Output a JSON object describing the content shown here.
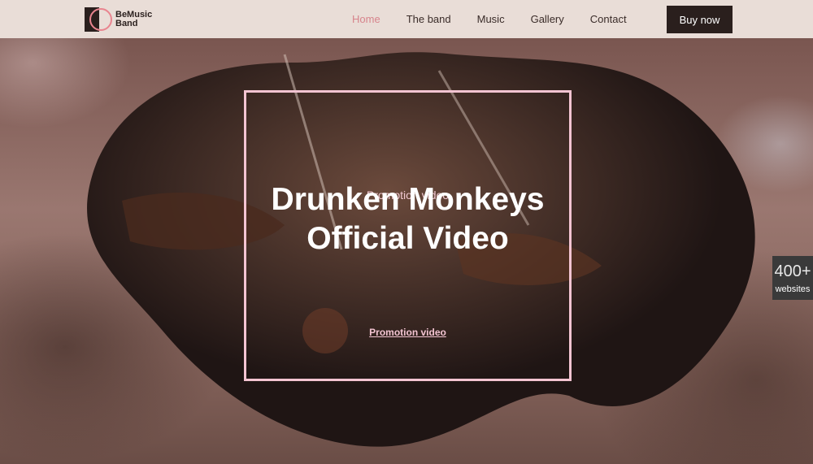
{
  "header": {
    "logo_text": "BeMusic Band",
    "nav": [
      {
        "label": "Home",
        "active": true
      },
      {
        "label": "The band",
        "active": false
      },
      {
        "label": "Music",
        "active": false
      },
      {
        "label": "Gallery",
        "active": false
      },
      {
        "label": "Contact",
        "active": false
      }
    ],
    "cta_label": "Buy now"
  },
  "hero": {
    "subtitle": "Promotion video",
    "title": "Drunken Monkeys Official Video",
    "link_label": "Promotion video"
  },
  "badge": {
    "count": "400+",
    "label": "websites"
  },
  "colors": {
    "accent_pink": "#d7848c",
    "frame_pink": "#f3c4d2",
    "dark": "#2a1f1d",
    "header_bg": "#e9ddd7"
  }
}
